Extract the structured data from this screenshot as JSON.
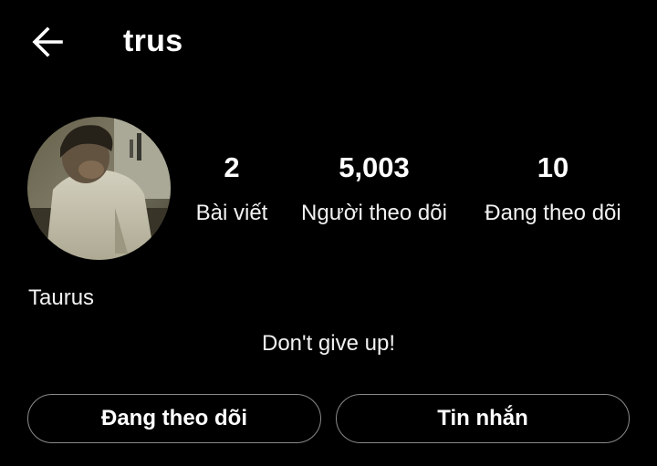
{
  "header": {
    "username": "trus",
    "back_icon": "arrow-left-icon"
  },
  "profile": {
    "avatar_icon": "profile-photo",
    "display_name": "Taurus",
    "bio": "Don't give up!"
  },
  "stats": [
    {
      "value": "2",
      "label": "Bài viết"
    },
    {
      "value": "5,003",
      "label": "Người theo dõi"
    },
    {
      "value": "10",
      "label": "Đang theo dõi"
    }
  ],
  "actions": {
    "following_label": "Đang theo dõi",
    "message_label": "Tin nhắn"
  },
  "colors": {
    "background": "#000000",
    "text": "#ffffff",
    "button_border": "#8a8a8a"
  }
}
